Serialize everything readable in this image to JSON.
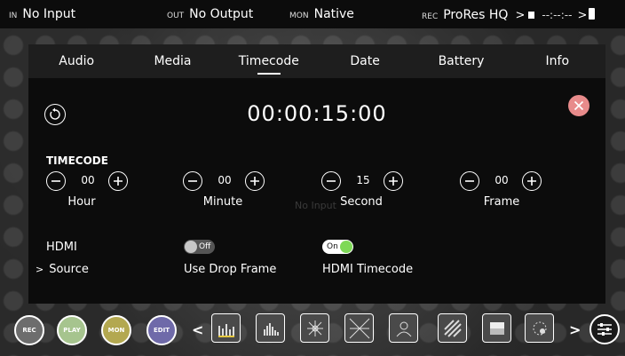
{
  "status": {
    "in_tag": "IN",
    "in_value": "No Input",
    "out_tag": "OUT",
    "out_value": "No Output",
    "mon_tag": "MON",
    "mon_value": "Native",
    "rec_tag": "REC",
    "rec_value": "ProRes HQ",
    "timecode": "--:--:--",
    "chevron": ">"
  },
  "tabs": [
    "Audio",
    "Media",
    "Timecode",
    "Date",
    "Battery",
    "Info"
  ],
  "active_tab": "Timecode",
  "timecode": {
    "display": "00:00:15:00",
    "section_label": "TIMECODE",
    "fields": [
      {
        "name": "Hour",
        "value": "00"
      },
      {
        "name": "Minute",
        "value": "00"
      },
      {
        "name": "Second",
        "value": "15"
      },
      {
        "name": "Frame",
        "value": "00"
      }
    ]
  },
  "watermark": "No Input",
  "hdmi": {
    "label": "HDMI",
    "source_label": "Source",
    "source_chevron": ">",
    "drop_frame_label": "Use Drop Frame",
    "drop_frame_state": "Off",
    "hdmi_timecode_label": "HDMI Timecode",
    "hdmi_timecode_state": "On"
  },
  "bottom": {
    "rec_label": "REC",
    "play_label": "PLAY",
    "mon_label": "MON",
    "edit_label": "EDIT",
    "left_chevron": "<",
    "right_chevron": ">",
    "tools": [
      "waveform-icon",
      "histogram-icon",
      "vectorscope-icon",
      "vectorscope-zoom-icon",
      "focus-peaking-icon",
      "zebra-icon",
      "false-color-icon",
      "frame-guides-icon"
    ]
  },
  "colors": {
    "accent_green": "#7ed957",
    "close_red": "#e88b8b",
    "mon_yellow": "#b3a850",
    "edit_purple": "#6f6aa9"
  }
}
